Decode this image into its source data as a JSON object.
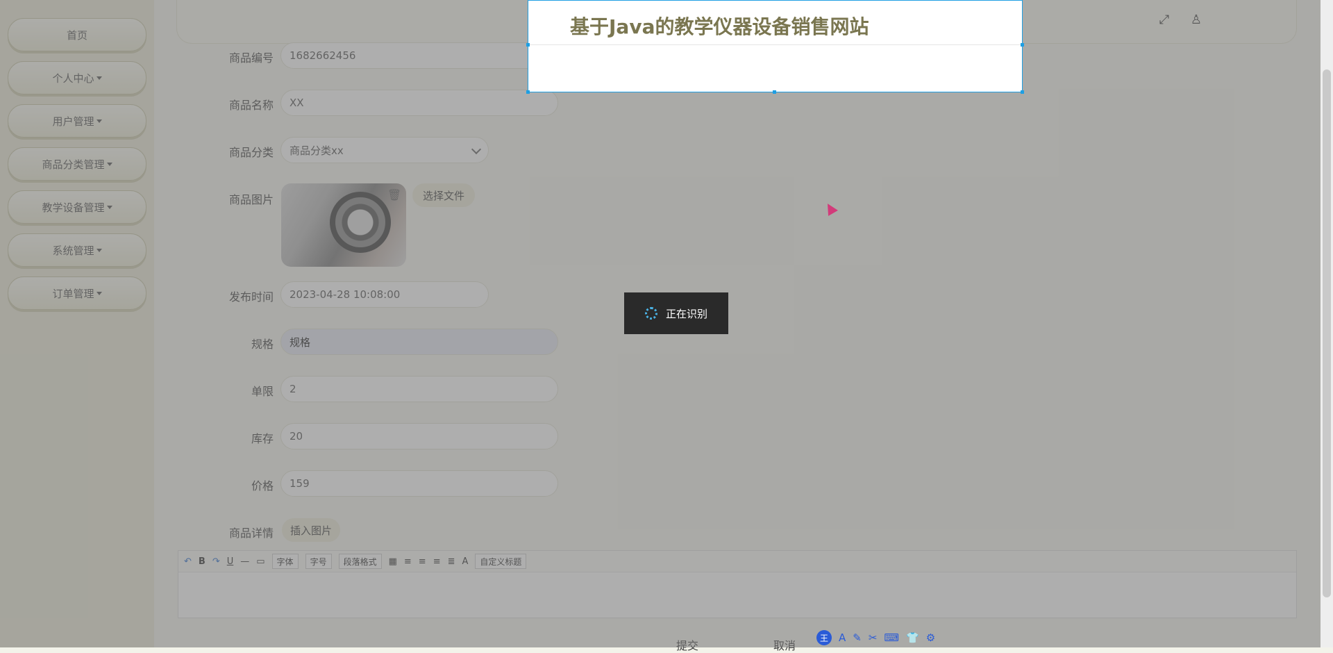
{
  "sidebar": {
    "items": [
      {
        "label": "首页",
        "dropdown": false
      },
      {
        "label": "个人中心",
        "dropdown": true
      },
      {
        "label": "用户管理",
        "dropdown": true
      },
      {
        "label": "商品分类管理",
        "dropdown": true
      },
      {
        "label": "教学设备管理",
        "dropdown": true
      },
      {
        "label": "系统管理",
        "dropdown": true
      },
      {
        "label": "订单管理",
        "dropdown": true
      }
    ]
  },
  "header": {
    "fullscreen_icon": "expand-icon",
    "user_icon": "user-icon"
  },
  "form": {
    "code": {
      "label": "商品编号",
      "value": "1682662456"
    },
    "name": {
      "label": "商品名称",
      "value": "XX"
    },
    "category": {
      "label": "商品分类",
      "value": "商品分类xx"
    },
    "image": {
      "label": "商品图片",
      "choose_label": "选择文件",
      "delete_icon": "trash-icon"
    },
    "publish_time": {
      "label": "发布时间",
      "value": "2023-04-28 10:08:00"
    },
    "spec": {
      "label": "规格",
      "value": "规格"
    },
    "limit": {
      "label": "单限",
      "value": "2"
    },
    "stock": {
      "label": "库存",
      "value": "20"
    },
    "price": {
      "label": "价格",
      "value": "159"
    },
    "detail": {
      "label": "商品详情",
      "insert_image_label": "插入图片"
    }
  },
  "editor": {
    "font_family": "字体",
    "font_size": "字号",
    "paragraph": "段落格式",
    "custom_title": "自定义标题"
  },
  "actions": {
    "submit_label": "提交",
    "cancel_label": "取消"
  },
  "capture": {
    "title": "基于Java的教学仪器设备销售网站"
  },
  "toast": {
    "text": "正在识别"
  },
  "ime": {
    "logo": "王",
    "font_icon": "A"
  }
}
